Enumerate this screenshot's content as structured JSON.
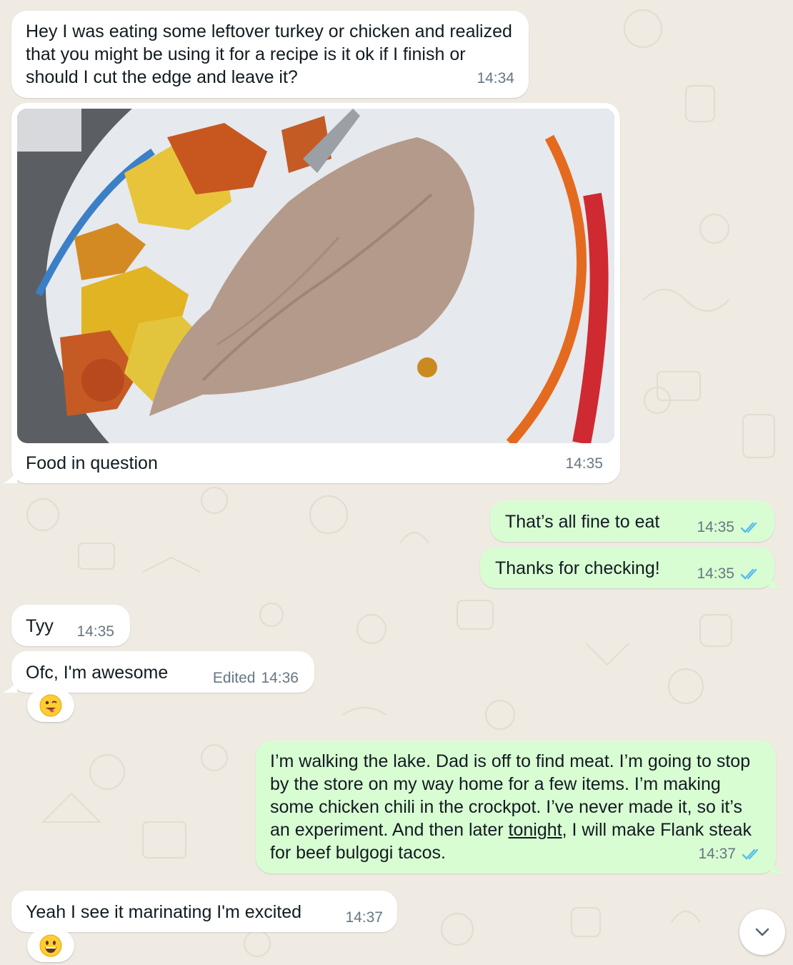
{
  "messages": {
    "m1": {
      "text": "Hey I was eating some leftover turkey or chicken and realized that you might be using it for a recipe is it ok if I finish or should I cut the edge and leave it?",
      "time": "14:34"
    },
    "m2": {
      "caption": "Food in question",
      "time": "14:35"
    },
    "m3": {
      "text": "That’s all fine to eat",
      "time": "14:35"
    },
    "m4": {
      "text": "Thanks for checking!",
      "time": "14:35"
    },
    "m5": {
      "text": "Tyy",
      "time": "14:35"
    },
    "m6": {
      "text": "Ofc, I'm awesome",
      "edited_label": "Edited",
      "time": "14:36",
      "reaction": "winking-face-with-tongue"
    },
    "m7": {
      "text_before": "I’m walking the lake. Dad is off to find meat. I’m going to stop by the store on my way home for a few items. I’m making some chicken chili in the crockpot. I’ve never made it, so it’s an experiment. And then later ",
      "link_text": "tonight",
      "text_after": ", I will make Flank steak for beef bulgogi tacos.",
      "time": "14:37"
    },
    "m8": {
      "text": "Yeah I see it marinating I'm excited",
      "time": "14:37",
      "reaction": "grinning-face"
    }
  },
  "colors": {
    "background": "#efeae2",
    "incoming_bubble": "#ffffff",
    "outgoing_bubble": "#d9fdd3",
    "read_ticks": "#53bdeb",
    "meta_text": "#667781"
  },
  "icons": {
    "read_receipt": "double-check-icon",
    "scroll_down": "chevron-down-icon"
  }
}
